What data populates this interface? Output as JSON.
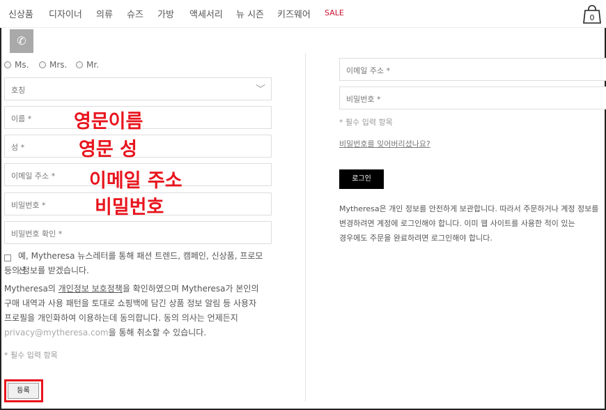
{
  "nav": {
    "items": [
      "신상품",
      "디자이너",
      "의류",
      "슈즈",
      "가방",
      "액세서리",
      "뉴 시즌",
      "키즈웨어"
    ],
    "sale": "SALE",
    "bag_count": "0",
    "sale_color": "#c8102e"
  },
  "register": {
    "salutations": [
      "Ms.",
      "Mrs.",
      "Mr."
    ],
    "title_select": "호칭",
    "first_name": "이름 *",
    "last_name": "성 *",
    "email": "이메일 주소 *",
    "password": "비밀번호 *",
    "password_confirm": "비밀번호 확인 *",
    "newsletter_line1": "예, Mytheresa 뉴스레터를 통해 패션 트렌드, 캠페인, 신상품, 프로모션",
    "newsletter_line2": "등의 정보를 받겠습니다.",
    "privacy_prefix": "Mytheresa의 ",
    "privacy_link": "개인정보 보호정책",
    "privacy_line1_suffix": "을 확인하였으며 Mytheresa가 본인의",
    "privacy_line2": "구매 내역과 사용 패턴을 토대로 쇼핑백에 담긴 상품 정보 알림 등 사용자",
    "privacy_line3": "프로필을 개인화하여 이용하는데 동의합니다. 동의 의사는 언제든지",
    "privacy_email": "privacy@mytheresa.com",
    "privacy_line4_suffix": "을 통해 취소할 수 있습니다.",
    "required_note": "* 필수 입력 항목",
    "submit": "등록"
  },
  "annotations": {
    "first_name": "영문이름",
    "last_name": "영문 성",
    "email": "이메일 주소",
    "password": "비밀번호",
    "color": "#e8141d"
  },
  "login": {
    "email": "이메일 주소 *",
    "password": "비밀번호 *",
    "required_note": "* 필수 입력 항목",
    "forgot": "비밀번호를 잊어버리셨나요?",
    "button": "로그인",
    "info_line1": "Mytheresa은 개인 정보를 안전하게 보관합니다. 따라서 주문하거나 계정 정보를",
    "info_line2": "변경하려면 계정에 로그인해야 합니다. 이미 웹 사이트를 사용한 적이 있는",
    "info_line3": "경우에도 주문을 완료하려면 로그인해야 합니다."
  }
}
